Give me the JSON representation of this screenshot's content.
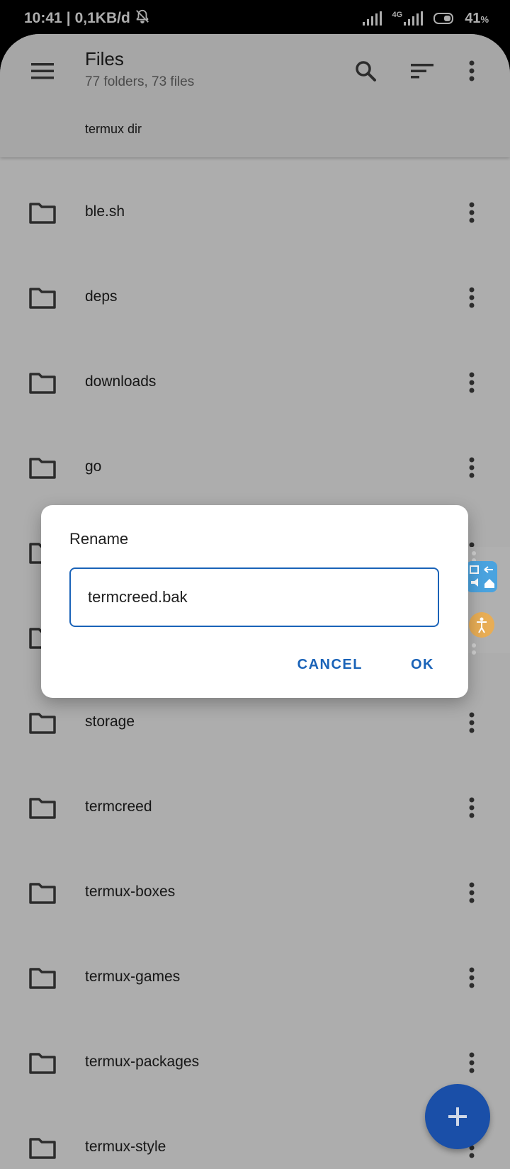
{
  "status_bar": {
    "time": "10:41",
    "separator": "|",
    "data_rate": "0,1KB/d",
    "network": "4G",
    "battery": "41",
    "battery_unit": "%"
  },
  "toolbar": {
    "title": "Files",
    "subtitle": "77 folders, 73 files",
    "breadcrumb": "termux dir"
  },
  "files": [
    {
      "name": "ble.sh"
    },
    {
      "name": "deps"
    },
    {
      "name": "downloads"
    },
    {
      "name": "go"
    },
    {
      "name": ""
    },
    {
      "name": ""
    },
    {
      "name": "storage"
    },
    {
      "name": "termcreed"
    },
    {
      "name": "termux-boxes"
    },
    {
      "name": "termux-games"
    },
    {
      "name": "termux-packages"
    },
    {
      "name": "termux-style"
    }
  ],
  "dialog": {
    "title": "Rename",
    "input_value": "termcreed.bak",
    "cancel_label": "CANCEL",
    "ok_label": "OK"
  },
  "colors": {
    "accent": "#1a63b8",
    "fab": "#1a4fa8",
    "toolbar_bg": "#f5f5f5"
  }
}
